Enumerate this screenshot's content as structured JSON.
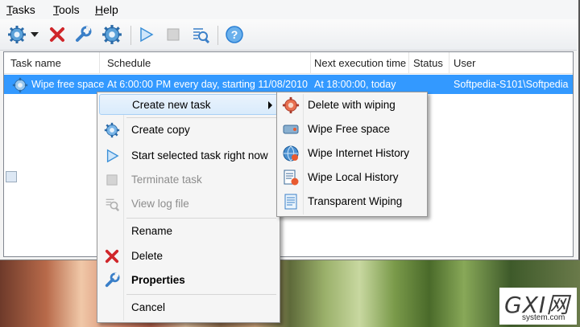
{
  "menubar": {
    "items": [
      {
        "label": "Tasks",
        "accel": "T",
        "rest": "asks"
      },
      {
        "label": "Tools",
        "accel": "T",
        "rest": "ools"
      },
      {
        "label": "Help",
        "accel": "H",
        "rest": "elp"
      }
    ]
  },
  "toolbar": {
    "buttons": [
      "new-task-gear-icon",
      "dropdown-arrow-icon",
      "delete-x-icon",
      "properties-wrench-icon",
      "settings-gear-icon",
      "run-play-icon",
      "stop-square-icon",
      "view-log-icon",
      "help-question-icon"
    ]
  },
  "table": {
    "columns": [
      "Task name",
      "Schedule",
      "Next execution time",
      "Status",
      "User"
    ],
    "rows": [
      {
        "name": "Wipe free space",
        "schedule": "At 6:00:00 PM every day, starting 11/08/2010",
        "next": "At 18:00:00, today",
        "status": "",
        "user": "Softpedia-S101\\Softpedia"
      }
    ]
  },
  "context_menu": {
    "items": [
      {
        "label": "Create new task",
        "icon": "none",
        "disabled": false,
        "submenu": true
      },
      {
        "label": "Create copy",
        "icon": "gear-copy-icon",
        "disabled": false
      },
      {
        "label": "Start selected task right now",
        "icon": "play-icon",
        "disabled": false
      },
      {
        "label": "Terminate task",
        "icon": "stop-icon",
        "disabled": true
      },
      {
        "label": "View log file",
        "icon": "view-log-icon",
        "disabled": true
      },
      {
        "label": "Rename",
        "icon": "none",
        "disabled": false
      },
      {
        "label": "Delete",
        "icon": "delete-x-icon",
        "disabled": false
      },
      {
        "label": "Properties",
        "icon": "wrench-icon",
        "disabled": false,
        "bold": true
      },
      {
        "label": "Cancel",
        "icon": "none",
        "disabled": false
      }
    ]
  },
  "submenu": {
    "items": [
      {
        "label": "Delete with wiping"
      },
      {
        "label": "Wipe Free space"
      },
      {
        "label": "Wipe Internet History"
      },
      {
        "label": "Wipe Local History"
      },
      {
        "label": "Transparent Wiping"
      }
    ]
  },
  "watermark": {
    "main": "GXI网",
    "sub": "system.com"
  },
  "colors": {
    "selection": "#3399ff",
    "highlight": "#d9ebfb",
    "delete_red": "#d0262a",
    "play_blue": "#3a8fd8",
    "help_blue": "#2a7fd4"
  }
}
